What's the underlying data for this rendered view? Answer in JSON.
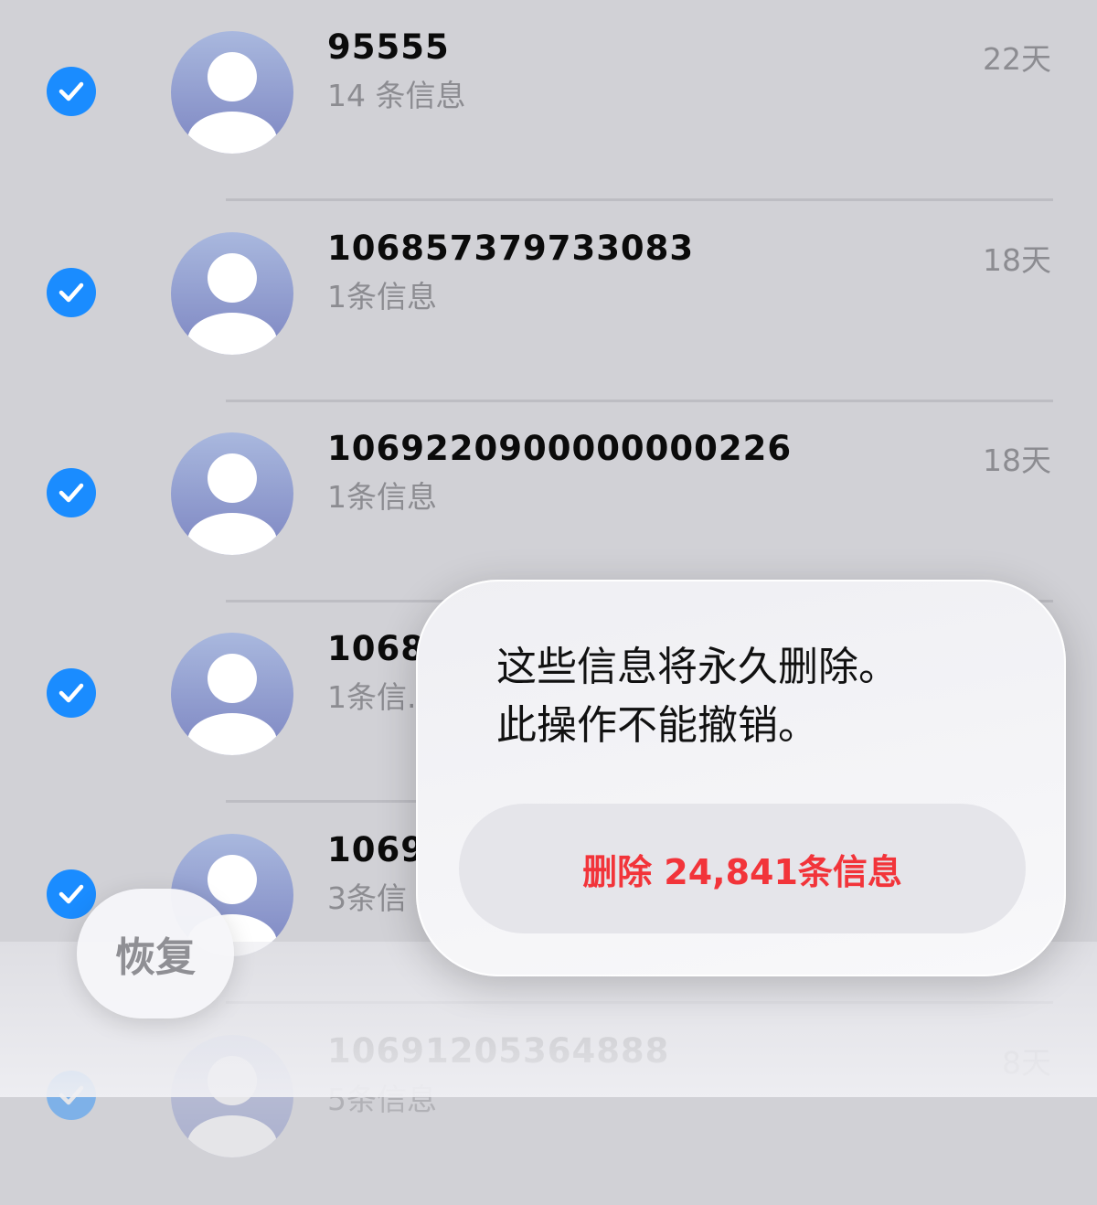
{
  "conversations": [
    {
      "title": "95555",
      "subtitle": "14 条信息",
      "date": "22天",
      "checked": true
    },
    {
      "title": "106857379733083",
      "subtitle": "1条信息",
      "date": "18天",
      "checked": true
    },
    {
      "title": "1069220900000000226",
      "subtitle": "1条信息",
      "date": "18天",
      "checked": true
    },
    {
      "title": "1068",
      "subtitle": "1条信.",
      "date": "",
      "checked": true
    },
    {
      "title": "1069",
      "subtitle": "3条信",
      "date": "",
      "checked": true
    },
    {
      "title": "10691205364888",
      "subtitle": "5条信息",
      "date": "8天",
      "checked": true
    }
  ],
  "recover_button": {
    "label": "恢复"
  },
  "dialog": {
    "message_line1": "这些信息将永久删除。",
    "message_line2": "此操作不能撤销。",
    "delete_button": "删除 24,841条信息"
  },
  "colors": {
    "accent": "#1a8cff",
    "destructive": "#f2343a",
    "background": "#d1d1d6"
  },
  "icons": {
    "checkmark": "checkmark-icon",
    "avatar": "person-avatar-icon"
  }
}
